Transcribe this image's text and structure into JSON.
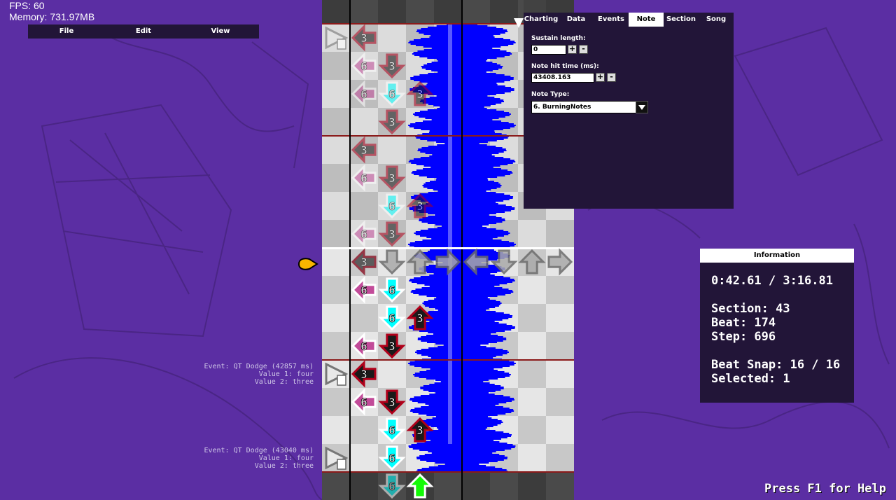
{
  "debug": {
    "fps": "FPS: 60",
    "memory": "Memory: 731.97MB"
  },
  "menu": {
    "items": [
      "File",
      "Edit",
      "View"
    ]
  },
  "tabs": [
    "Charting",
    "Data",
    "Events",
    "Note",
    "Section",
    "Song"
  ],
  "active_tab": "Note",
  "note_panel": {
    "sustain_label": "Sustain length:",
    "sustain_value": "0",
    "hit_time_label": "Note hit time (ms):",
    "hit_time_value": "43408.163",
    "type_label": "Note Type:",
    "type_value": "6. BurningNotes",
    "plus": "+",
    "minus": "-"
  },
  "info": {
    "title": "Information",
    "time": "0:42.61 / 3:16.81",
    "section": "Section: 43",
    "beat": "Beat: 174",
    "step": "Step: 696",
    "snap": "Beat Snap: 16 / 16",
    "selected": "Selected: 1"
  },
  "events": [
    {
      "line1": "Event: QT Dodge (42857 ms)",
      "line2": "Value 1: four",
      "line3": "Value 2: three"
    },
    {
      "line1": "Event: QT Dodge (43040 ms)",
      "line2": "Value 1: four",
      "line3": "Value 2: three"
    }
  ],
  "help": "Press F1 for Help",
  "colors": {
    "background": "#5b2ea3",
    "panel": "#221538",
    "waveform": "#0000ff",
    "left_note": "#c24b99",
    "down_note": "#00ffff",
    "up_note": "#12fa05",
    "burning_note": "#1a1a1a"
  },
  "notes": [
    {
      "row": 0,
      "lane": 1,
      "type": "3",
      "dim": true
    },
    {
      "row": 1,
      "lane": 1,
      "type": "6",
      "dim": true
    },
    {
      "row": 1,
      "lane": 2,
      "type": "3",
      "dim": true
    },
    {
      "row": 2,
      "lane": 1,
      "type": "6",
      "dim": true
    },
    {
      "row": 2,
      "lane": 2,
      "type": "6",
      "dim": true
    },
    {
      "row": 2,
      "lane": 3,
      "type": "3",
      "dim": true
    },
    {
      "row": 3,
      "lane": 2,
      "type": "3",
      "dim": true
    },
    {
      "row": 4,
      "lane": 1,
      "type": "3",
      "dim": true
    },
    {
      "row": 5,
      "lane": 1,
      "type": "6",
      "dim": true
    },
    {
      "row": 5,
      "lane": 2,
      "type": "3",
      "dim": true
    },
    {
      "row": 6,
      "lane": 2,
      "type": "6",
      "dim": true
    },
    {
      "row": 6,
      "lane": 3,
      "type": "3",
      "dim": true
    },
    {
      "row": 7,
      "lane": 1,
      "type": "6",
      "dim": true
    },
    {
      "row": 7,
      "lane": 2,
      "type": "3",
      "dim": true
    },
    {
      "row": 8,
      "lane": 1,
      "type": "3",
      "dim": true
    },
    {
      "row": 9,
      "lane": 1,
      "type": "6"
    },
    {
      "row": 9,
      "lane": 2,
      "type": "6"
    },
    {
      "row": 10,
      "lane": 2,
      "type": "6"
    },
    {
      "row": 10,
      "lane": 3,
      "type": "3"
    },
    {
      "row": 11,
      "lane": 1,
      "type": "6"
    },
    {
      "row": 11,
      "lane": 2,
      "type": "3"
    },
    {
      "row": 12,
      "lane": 1,
      "type": "3"
    },
    {
      "row": 13,
      "lane": 1,
      "type": "6"
    },
    {
      "row": 13,
      "lane": 2,
      "type": "3"
    },
    {
      "row": 14,
      "lane": 2,
      "type": "6"
    },
    {
      "row": 14,
      "lane": 3,
      "type": "3"
    },
    {
      "row": 15,
      "lane": 2,
      "type": "6"
    },
    {
      "row": 16,
      "lane": 2,
      "type": "6",
      "dim": true
    }
  ]
}
